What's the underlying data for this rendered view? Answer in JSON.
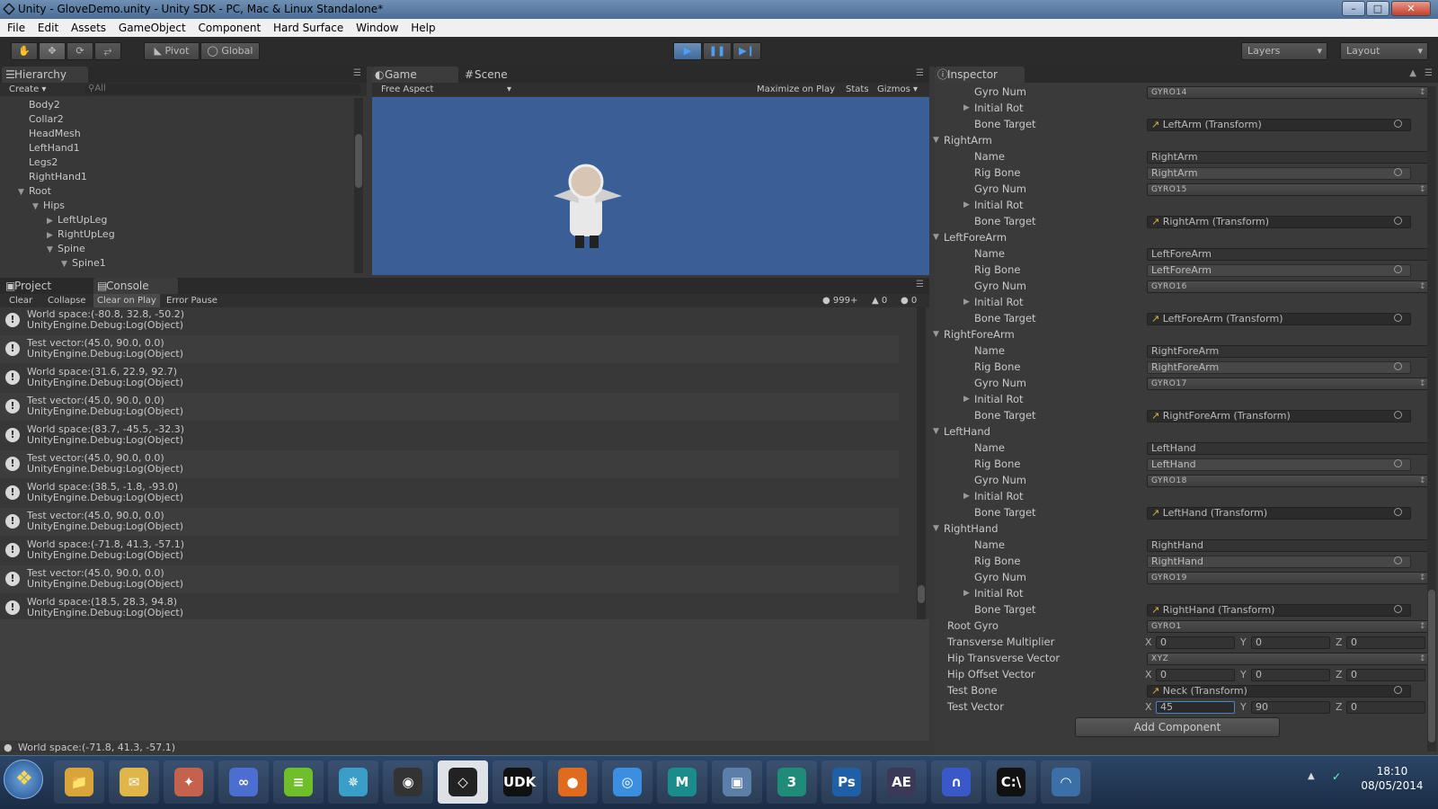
{
  "window": {
    "title": "Unity - GloveDemo.unity - Unity SDK - PC, Mac & Linux Standalone*",
    "min": "–",
    "max": "□",
    "close": "✕"
  },
  "menu": [
    "File",
    "Edit",
    "Assets",
    "GameObject",
    "Component",
    "Hard Surface",
    "Window",
    "Help"
  ],
  "toolbar": {
    "pivot": "Pivot",
    "global": "Global",
    "layers": "Layers",
    "layout": "Layout"
  },
  "hierarchy": {
    "tab": "Hierarchy",
    "create": "Create",
    "search_placeholder": "All",
    "items": [
      {
        "label": "Body2",
        "arrow": ""
      },
      {
        "label": "Collar2",
        "arrow": ""
      },
      {
        "label": "HeadMesh",
        "arrow": ""
      },
      {
        "label": "LeftHand1",
        "arrow": ""
      },
      {
        "label": "Legs2",
        "arrow": ""
      },
      {
        "label": "RightHand1",
        "arrow": ""
      },
      {
        "label": "Root",
        "arrow": "▼"
      },
      {
        "label": "Hips",
        "arrow": "▼"
      },
      {
        "label": "LeftUpLeg",
        "arrow": "▶"
      },
      {
        "label": "RightUpLeg",
        "arrow": "▶"
      },
      {
        "label": "Spine",
        "arrow": "▼"
      },
      {
        "label": "Spine1",
        "arrow": "▼"
      }
    ]
  },
  "game": {
    "tab_game": "Game",
    "tab_scene": "Scene",
    "aspect": "Free Aspect",
    "maximize": "Maximize on Play",
    "stats": "Stats",
    "gizmos": "Gizmos",
    "bg_color": "#3a5f96"
  },
  "console": {
    "tab_project": "Project",
    "tab_console": "Console",
    "clear": "Clear",
    "collapse": "Collapse",
    "clear_on_play": "Clear on Play",
    "error_pause": "Error Pause",
    "count_log": "999+",
    "count_warn": "0",
    "count_err": "0",
    "entries": [
      {
        "line1": "World space:(-80.8, 32.8, -50.2)",
        "line2": "UnityEngine.Debug:Log(Object)"
      },
      {
        "line1": "Test vector:(45.0, 90.0, 0.0)",
        "line2": "UnityEngine.Debug:Log(Object)"
      },
      {
        "line1": "World space:(31.6, 22.9, 92.7)",
        "line2": "UnityEngine.Debug:Log(Object)"
      },
      {
        "line1": "Test vector:(45.0, 90.0, 0.0)",
        "line2": "UnityEngine.Debug:Log(Object)"
      },
      {
        "line1": "World space:(83.7, -45.5, -32.3)",
        "line2": "UnityEngine.Debug:Log(Object)"
      },
      {
        "line1": "Test vector:(45.0, 90.0, 0.0)",
        "line2": "UnityEngine.Debug:Log(Object)"
      },
      {
        "line1": "World space:(38.5, -1.8, -93.0)",
        "line2": "UnityEngine.Debug:Log(Object)"
      },
      {
        "line1": "Test vector:(45.0, 90.0, 0.0)",
        "line2": "UnityEngine.Debug:Log(Object)"
      },
      {
        "line1": "World space:(-71.8, 41.3, -57.1)",
        "line2": "UnityEngine.Debug:Log(Object)"
      },
      {
        "line1": "Test vector:(45.0, 90.0, 0.0)",
        "line2": "UnityEngine.Debug:Log(Object)"
      },
      {
        "line1": "World space:(18.5, 28.3, 94.8)",
        "line2": "UnityEngine.Debug:Log(Object)"
      }
    ]
  },
  "inspector": {
    "tab": "Inspector",
    "rows": [
      {
        "label": "Gyro Num",
        "kind": "drop",
        "value": "GYRO14",
        "indent": 2
      },
      {
        "label": "Initial Rot",
        "kind": "fold",
        "indent": 2
      },
      {
        "label": "Bone Target",
        "kind": "obj",
        "value": "LeftArm (Transform)",
        "indent": 2
      },
      {
        "label": "RightArm",
        "kind": "group",
        "indent": 1
      },
      {
        "label": "Name",
        "kind": "text",
        "value": "RightArm",
        "indent": 2
      },
      {
        "label": "Rig Bone",
        "kind": "light",
        "value": "RightArm",
        "indent": 2
      },
      {
        "label": "Gyro Num",
        "kind": "drop",
        "value": "GYRO15",
        "indent": 2
      },
      {
        "label": "Initial Rot",
        "kind": "fold",
        "indent": 2
      },
      {
        "label": "Bone Target",
        "kind": "obj",
        "value": "RightArm (Transform)",
        "indent": 2
      },
      {
        "label": "LeftForeArm",
        "kind": "group",
        "indent": 1
      },
      {
        "label": "Name",
        "kind": "text",
        "value": "LeftForeArm",
        "indent": 2
      },
      {
        "label": "Rig Bone",
        "kind": "light",
        "value": "LeftForeArm",
        "indent": 2
      },
      {
        "label": "Gyro Num",
        "kind": "drop",
        "value": "GYRO16",
        "indent": 2
      },
      {
        "label": "Initial Rot",
        "kind": "fold",
        "indent": 2
      },
      {
        "label": "Bone Target",
        "kind": "obj",
        "value": "LeftForeArm (Transform)",
        "indent": 2
      },
      {
        "label": "RightForeArm",
        "kind": "group",
        "indent": 1
      },
      {
        "label": "Name",
        "kind": "text",
        "value": "RightForeArm",
        "indent": 2
      },
      {
        "label": "Rig Bone",
        "kind": "light",
        "value": "RightForeArm",
        "indent": 2
      },
      {
        "label": "Gyro Num",
        "kind": "drop",
        "value": "GYRO17",
        "indent": 2
      },
      {
        "label": "Initial Rot",
        "kind": "fold",
        "indent": 2
      },
      {
        "label": "Bone Target",
        "kind": "obj",
        "value": "RightForeArm (Transform)",
        "indent": 2
      },
      {
        "label": "LeftHand",
        "kind": "group",
        "indent": 1
      },
      {
        "label": "Name",
        "kind": "text",
        "value": "LeftHand",
        "indent": 2
      },
      {
        "label": "Rig Bone",
        "kind": "light",
        "value": "LeftHand",
        "indent": 2
      },
      {
        "label": "Gyro Num",
        "kind": "drop",
        "value": "GYRO18",
        "indent": 2
      },
      {
        "label": "Initial Rot",
        "kind": "fold",
        "indent": 2
      },
      {
        "label": "Bone Target",
        "kind": "obj",
        "value": "LeftHand (Transform)",
        "indent": 2
      },
      {
        "label": "RightHand",
        "kind": "group",
        "indent": 1
      },
      {
        "label": "Name",
        "kind": "text",
        "value": "RightHand",
        "indent": 2
      },
      {
        "label": "Rig Bone",
        "kind": "light",
        "value": "RightHand",
        "indent": 2
      },
      {
        "label": "Gyro Num",
        "kind": "drop",
        "value": "GYRO19",
        "indent": 2
      },
      {
        "label": "Initial Rot",
        "kind": "fold",
        "indent": 2
      },
      {
        "label": "Bone Target",
        "kind": "obj",
        "value": "RightHand (Transform)",
        "indent": 2
      },
      {
        "label": "Root Gyro",
        "kind": "drop",
        "value": "GYRO1",
        "indent": 0
      },
      {
        "label": "Transverse Multiplier",
        "kind": "vec",
        "x": "0",
        "y": "0",
        "z": "0",
        "indent": 0
      },
      {
        "label": "Hip Transverse Vector",
        "kind": "drop",
        "value": "XYZ",
        "indent": 0
      },
      {
        "label": "Hip Offset Vector",
        "kind": "vec",
        "x": "0",
        "y": "0",
        "z": "0",
        "indent": 0
      },
      {
        "label": "Test Bone",
        "kind": "obj",
        "value": "Neck (Transform)",
        "indent": 0
      },
      {
        "label": "Test Vector",
        "kind": "vec",
        "x": "45",
        "y": "90",
        "z": "0",
        "indent": 0,
        "focus": true
      }
    ],
    "add_component": "Add Component"
  },
  "statusbar": {
    "text": "World space:(-71.8, 41.3, -57.1)"
  },
  "taskbar": {
    "clock_time": "18:10",
    "clock_date": "08/05/2014",
    "apps": [
      {
        "name": "explorer-icon",
        "glyph": "📁",
        "color": "#d9a53a"
      },
      {
        "name": "notes-icon",
        "glyph": "✉",
        "color": "#e0b64a"
      },
      {
        "name": "paint-icon",
        "glyph": "✦",
        "color": "#c4624e"
      },
      {
        "name": "infinity-icon",
        "glyph": "∞",
        "color": "#4a6fd0"
      },
      {
        "name": "spotify-icon",
        "glyph": "≡",
        "color": "#6fbf2b"
      },
      {
        "name": "settings-icon",
        "glyph": "✵",
        "color": "#3a9ec8"
      },
      {
        "name": "steam-icon",
        "glyph": "◉",
        "color": "#333333"
      },
      {
        "name": "unity-icon",
        "glyph": "◇",
        "color": "#222222"
      },
      {
        "name": "udk-icon",
        "glyph": "UDK",
        "color": "#111111"
      },
      {
        "name": "firefox-icon",
        "glyph": "●",
        "color": "#e06b1e"
      },
      {
        "name": "chrome-icon",
        "glyph": "◎",
        "color": "#3b8ee0"
      },
      {
        "name": "maya-icon",
        "glyph": "M",
        "color": "#1a8c8c"
      },
      {
        "name": "cube-icon",
        "glyph": "▣",
        "color": "#5b7fa8"
      },
      {
        "name": "max-icon",
        "glyph": "3",
        "color": "#1f8c7a"
      },
      {
        "name": "photoshop-icon",
        "glyph": "Ps",
        "color": "#1f5fa8"
      },
      {
        "name": "aftereffects-icon",
        "glyph": "AE",
        "color": "#3a3a58"
      },
      {
        "name": "headphones-icon",
        "glyph": "∩",
        "color": "#3a58c8"
      },
      {
        "name": "cmd-icon",
        "glyph": "C:\\",
        "color": "#111111"
      },
      {
        "name": "wifi-icon",
        "glyph": "◠",
        "color": "#3b6fa8"
      }
    ]
  }
}
